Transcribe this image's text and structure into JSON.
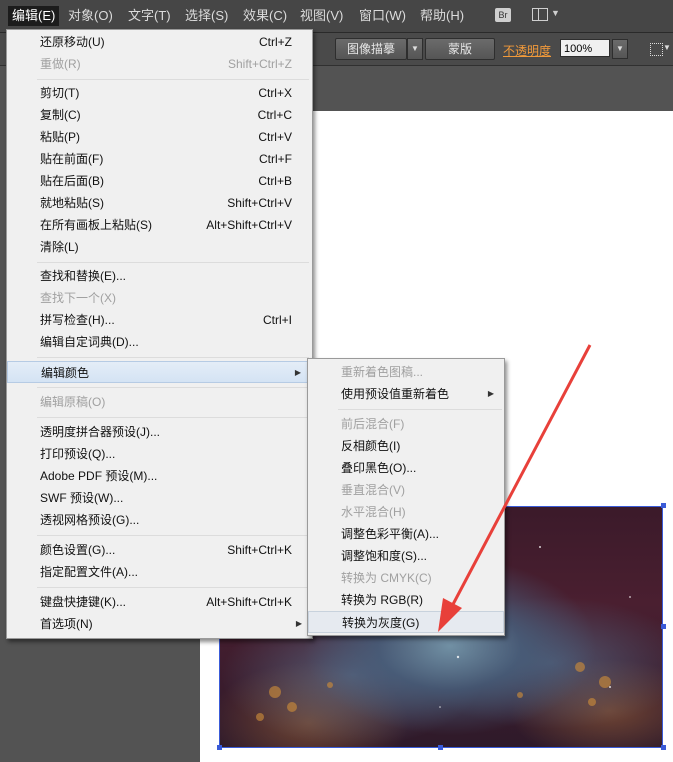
{
  "menubar": {
    "items": [
      {
        "label": "编辑(E)",
        "active": true
      },
      {
        "label": "对象(O)"
      },
      {
        "label": "文字(T)"
      },
      {
        "label": "选择(S)"
      },
      {
        "label": "效果(C)"
      },
      {
        "label": "视图(V)"
      },
      {
        "label": "窗口(W)"
      },
      {
        "label": "帮助(H)"
      }
    ],
    "bridge_icon_text": "Br"
  },
  "controlbar": {
    "image_trace_button": "图像描摹",
    "mask_button": "蒙版",
    "opacity_label": "不透明度",
    "opacity_value": "100%",
    "accent_color": "#f29a3a"
  },
  "edit_menu": {
    "items": [
      {
        "label": "还原移动(U)",
        "shortcut": "Ctrl+Z"
      },
      {
        "label": "重做(R)",
        "shortcut": "Shift+Ctrl+Z",
        "disabled": true
      },
      {
        "label": "剪切(T)",
        "shortcut": "Ctrl+X"
      },
      {
        "label": "复制(C)",
        "shortcut": "Ctrl+C"
      },
      {
        "label": "粘贴(P)",
        "shortcut": "Ctrl+V"
      },
      {
        "label": "贴在前面(F)",
        "shortcut": "Ctrl+F"
      },
      {
        "label": "贴在后面(B)",
        "shortcut": "Ctrl+B"
      },
      {
        "label": "就地粘贴(S)",
        "shortcut": "Shift+Ctrl+V"
      },
      {
        "label": "在所有画板上粘贴(S)",
        "shortcut": "Alt+Shift+Ctrl+V"
      },
      {
        "label": "清除(L)",
        "shortcut": ""
      },
      {
        "label": "查找和替换(E)...",
        "shortcut": ""
      },
      {
        "label": "查找下一个(X)",
        "shortcut": "",
        "disabled": true
      },
      {
        "label": "拼写检查(H)...",
        "shortcut": "Ctrl+I"
      },
      {
        "label": "编辑自定词典(D)...",
        "shortcut": ""
      },
      {
        "label": "编辑颜色",
        "shortcut": "",
        "submenu": true,
        "highlighted": true
      },
      {
        "label": "编辑原稿(O)",
        "shortcut": "",
        "disabled": true
      },
      {
        "label": "透明度拼合器预设(J)...",
        "shortcut": ""
      },
      {
        "label": "打印预设(Q)...",
        "shortcut": ""
      },
      {
        "label": "Adobe PDF 预设(M)...",
        "shortcut": ""
      },
      {
        "label": "SWF 预设(W)...",
        "shortcut": ""
      },
      {
        "label": "透视网格预设(G)...",
        "shortcut": ""
      },
      {
        "label": "颜色设置(G)...",
        "shortcut": "Shift+Ctrl+K"
      },
      {
        "label": "指定配置文件(A)...",
        "shortcut": ""
      },
      {
        "label": "键盘快捷键(K)...",
        "shortcut": "Alt+Shift+Ctrl+K"
      },
      {
        "label": "首选项(N)",
        "shortcut": "",
        "submenu": true
      }
    ]
  },
  "edit_colors_submenu": {
    "items": [
      {
        "label": "重新着色图稿...",
        "disabled": true
      },
      {
        "label": "使用预设值重新着色",
        "submenu": true
      },
      {
        "label": "前后混合(F)",
        "disabled": true
      },
      {
        "label": "反相颜色(I)"
      },
      {
        "label": "叠印黑色(O)..."
      },
      {
        "label": "垂直混合(V)",
        "disabled": true
      },
      {
        "label": "水平混合(H)",
        "disabled": true
      },
      {
        "label": "调整色彩平衡(A)..."
      },
      {
        "label": "调整饱和度(S)..."
      },
      {
        "label": "转换为 CMYK(C)",
        "disabled": true
      },
      {
        "label": "转换为 RGB(R)"
      },
      {
        "label": "转换为灰度(G)",
        "hovered": true
      }
    ]
  },
  "annotation": {
    "arrow_color": "#e8403a"
  }
}
